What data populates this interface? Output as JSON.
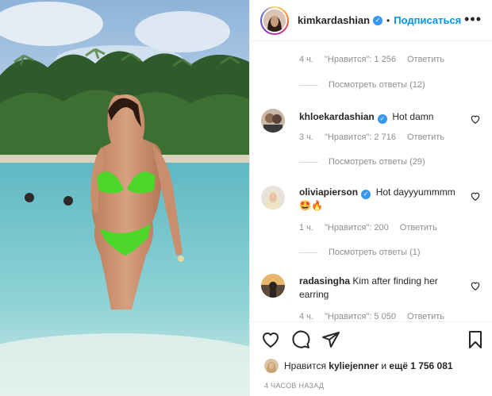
{
  "post": {
    "username": "kimkardashian",
    "follow_label": "Подписаться",
    "separator": "•",
    "more_label": "•••"
  },
  "comments": {
    "first_meta": {
      "time": "4 ч.",
      "likes": "\"Нравится\": 1 256",
      "reply": "Ответить",
      "view_replies": "Посмотреть ответы (12)"
    },
    "items": [
      {
        "username": "khloekardashian",
        "text": "Hot damn",
        "time": "3 ч.",
        "likes": "\"Нравится\": 2 716",
        "reply": "Ответить",
        "view_replies": "Посмотреть ответы (29)"
      },
      {
        "username": "oliviapierson",
        "text": "Hot dayyyummmm 🤩🔥",
        "time": "1 ч.",
        "likes": "\"Нравится\": 200",
        "reply": "Ответить",
        "view_replies": "Посмотреть ответы (1)"
      },
      {
        "username": "radasingha",
        "text": "Kim after finding her earring",
        "time": "4 ч.",
        "likes": "\"Нравится\": 5 050",
        "reply": "Ответить"
      }
    ]
  },
  "likes": {
    "prefix": "Нравится",
    "user": "kyliejenner",
    "conjunction": "и",
    "others": "ещё 1 756 081"
  },
  "timestamp": "4 ЧАСОВ НАЗАД",
  "colors": {
    "accent": "#0095f6",
    "verified": "#3897f0",
    "secondary_text": "#8e8e8e"
  },
  "icons": [
    "heart-icon",
    "comment-icon",
    "share-icon",
    "bookmark-icon",
    "more-icon",
    "verified-icon"
  ]
}
